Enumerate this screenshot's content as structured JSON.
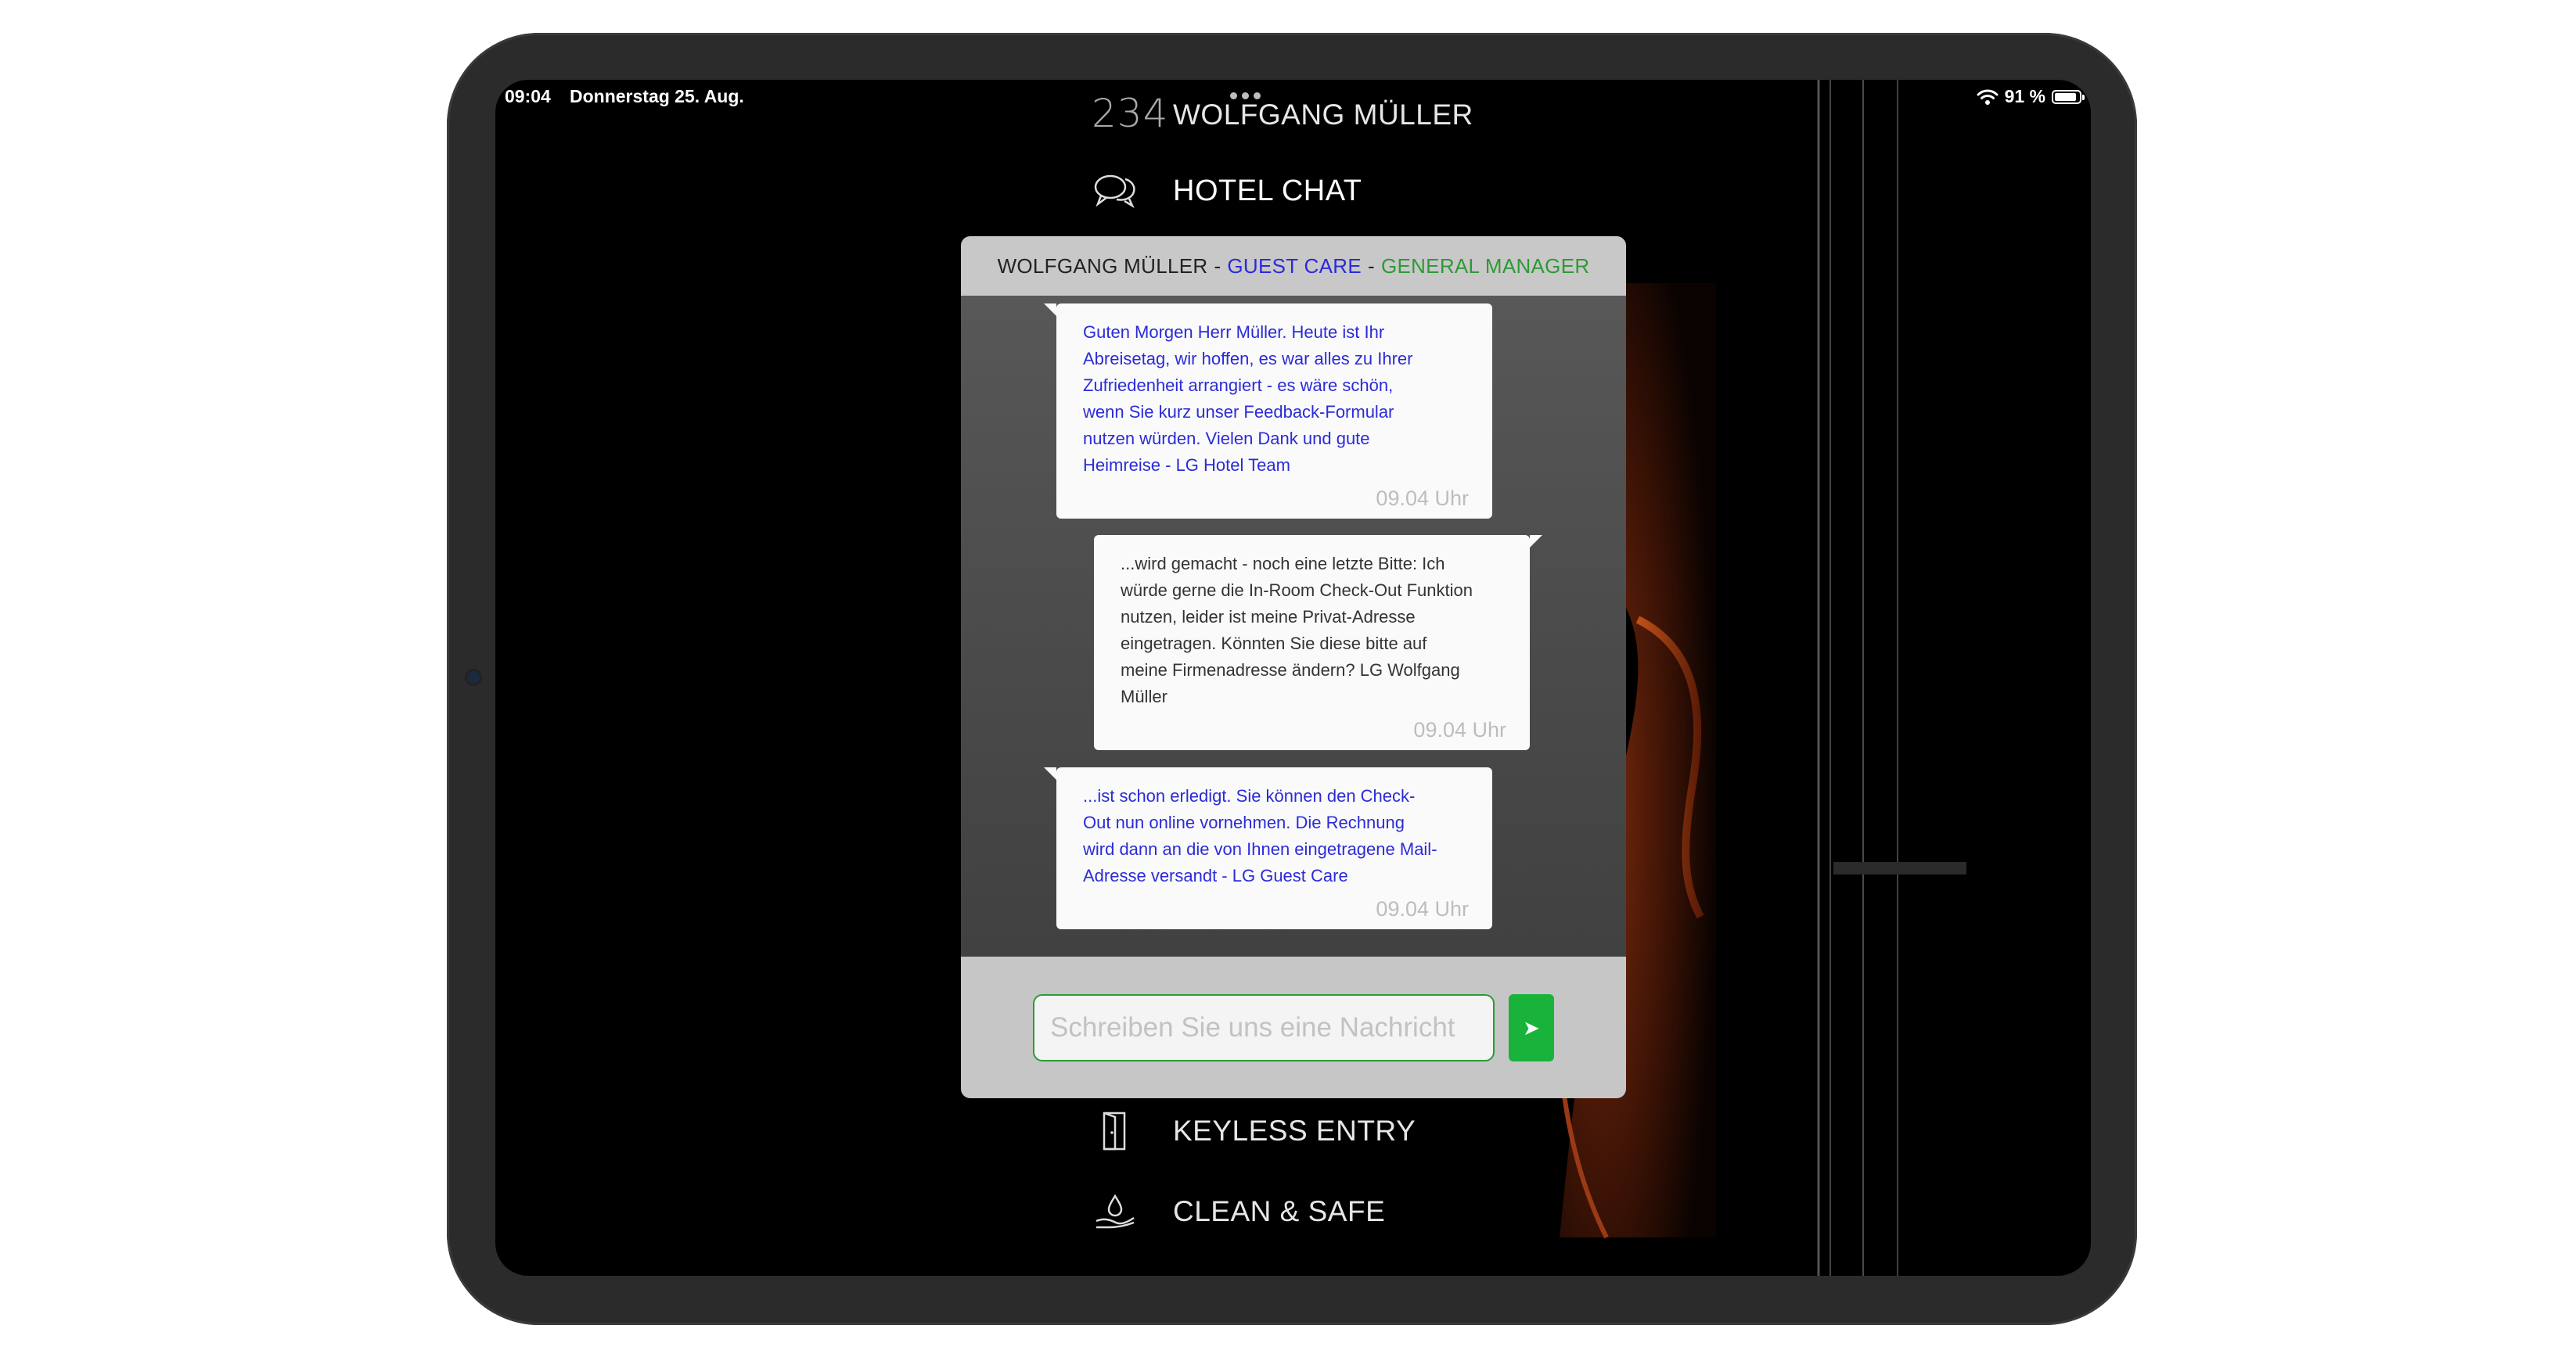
{
  "status_bar": {
    "time": "09:04",
    "date": "Donnerstag 25. Aug.",
    "battery": "91 %",
    "battery_level": 0.91
  },
  "guest": {
    "room_number": "234",
    "name": "WOLFGANG MÜLLER"
  },
  "menu": {
    "hotel_chat": "HOTEL CHAT",
    "keyless_entry": "KEYLESS ENTRY",
    "clean_safe": "CLEAN & SAFE"
  },
  "chat": {
    "header": {
      "name": "WOLFGANG MÜLLER",
      "separator": "-",
      "department": "GUEST CARE",
      "role": "GENERAL MANAGER"
    },
    "messages": [
      {
        "sender": "hotel",
        "text": "Guten Morgen Herr Müller. Heute ist Ihr\nAbreisetag, wir hoffen, es war alles zu Ihrer\nZufriedenheit arrangiert - es wäre schön,\nwenn Sie kurz unser Feedback-Formular\nnutzen würden. Vielen Dank und gute\nHeimreise - LG Hotel Team",
        "time": "09.04 Uhr"
      },
      {
        "sender": "guest",
        "text": "...wird gemacht - noch eine letzte Bitte: Ich\nwürde gerne die In-Room Check-Out Funktion\nnutzen, leider ist meine Privat-Adresse\neingetragen. Könnten Sie diese bitte auf\nmeine Firmenadresse ändern? LG Wolfgang\nMüller",
        "time": "09.04 Uhr"
      },
      {
        "sender": "hotel",
        "text": "...ist schon erledigt. Sie können den Check-\nOut nun online vornehmen. Die Rechnung\nwird dann an die von Ihnen eingetragene Mail-\nAdresse versandt - LG Guest Care",
        "time": "09.04 Uhr"
      }
    ],
    "input_placeholder": "Schreiben Sie uns eine Nachricht",
    "input_value": "",
    "send_icon": "➤"
  },
  "icons": {
    "chat": "chat-bubbles-icon",
    "door": "door-icon",
    "clean": "water-drop-hand-icon",
    "wifi": "wifi-icon",
    "battery": "battery-icon"
  },
  "colors": {
    "hotel_text": "#2b2bd9",
    "guest_text": "#333333",
    "department": "#2b2bd9",
    "role": "#2e9a36",
    "send_button": "#19b33b",
    "input_border": "#2e9a36"
  }
}
